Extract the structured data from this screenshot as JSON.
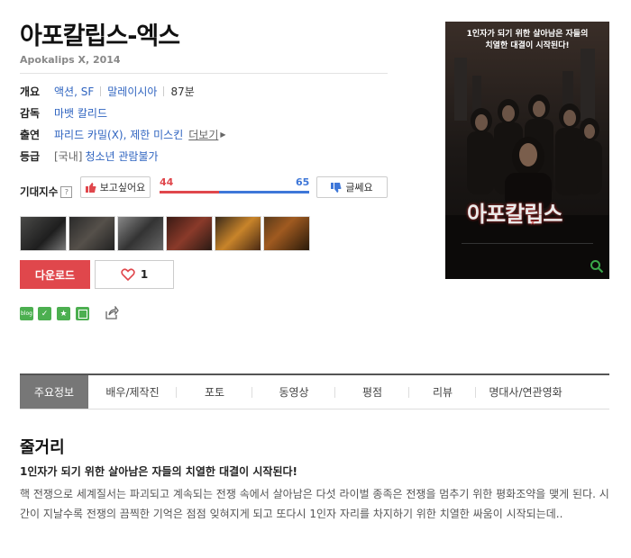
{
  "movie": {
    "title": "아포칼립스-엑스",
    "original": "Apokalips X, 2014"
  },
  "info": {
    "overview": {
      "label": "개요",
      "genre": "액션, SF",
      "country": "말레이시아",
      "runtime": "87분"
    },
    "director": {
      "label": "감독",
      "name": "마뱃 칼리드"
    },
    "cast": {
      "label": "출연",
      "names": "파리드 카밀(X), 제한 미스킨",
      "more": "더보기"
    },
    "rating": {
      "label": "등급",
      "prefix": "[국내]",
      "value": "청소년 관람불가"
    }
  },
  "expect": {
    "label": "기대지수",
    "help": "?",
    "want_label": "보고싶어요",
    "meh_label": "글쎄요",
    "want_count": "44",
    "meh_count": "65",
    "want_ratio": 0.4,
    "colors": {
      "want": "#e0474c",
      "meh": "#3e77d8"
    }
  },
  "thumbnails": [
    {
      "name": "still-1"
    },
    {
      "name": "still-2"
    },
    {
      "name": "still-3"
    },
    {
      "name": "still-4"
    },
    {
      "name": "still-5"
    },
    {
      "name": "still-6"
    }
  ],
  "actions": {
    "download_label": "다운로드",
    "like_count": "1",
    "share_icons": [
      "blog-icon",
      "talk-icon",
      "star-icon",
      "box-icon"
    ],
    "share_icon": "share-icon"
  },
  "poster": {
    "tagline": "1인자가 되기 위한 살아남은 자들의\n치열한 대결이 시작된다!",
    "logo": "아포칼립스",
    "zoom_icon": "search-icon"
  },
  "tabs": [
    {
      "label": "주요정보",
      "active": true
    },
    {
      "label": "배우/제작진"
    },
    {
      "label": "포토"
    },
    {
      "label": "동영상"
    },
    {
      "label": "평점"
    },
    {
      "label": "리뷰"
    },
    {
      "label": "명대사/연관영화"
    }
  ],
  "synopsis": {
    "heading": "줄거리",
    "tagline": "1인자가 되기 위한 살아남은 자들의 치열한 대결이 시작된다!",
    "body": "핵 전쟁으로 세계질서는 파괴되고 계속되는 전쟁 속에서 살아남은 다섯 라이벌 종족은 전쟁을 멈추기 위한 평화조약을 맺게 된다. 시간이 지날수록 전쟁의 끔찍한 기억은 점점 잊혀지게 되고 또다시 1인자 자리를 차지하기 위한 치열한 싸움이 시작되는데.."
  }
}
